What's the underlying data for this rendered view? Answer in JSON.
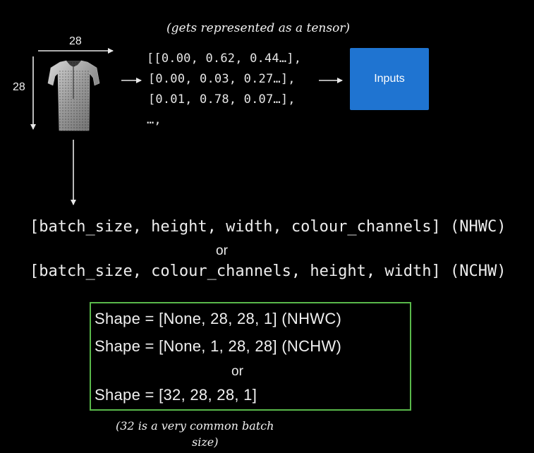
{
  "annotation_top": "(gets represented as a tensor)",
  "image_width_label": "28",
  "image_height_label": "28",
  "tensor_lines": [
    "[[0.00, 0.62, 0.44…],",
    "[0.00, 0.03, 0.27…],",
    "[0.01, 0.78, 0.07…],",
    "…,"
  ],
  "inputs_label": "Inputs",
  "formats": {
    "nhwc": "[batch_size, height, width, colour_channels] (NHWC)",
    "or": "or",
    "nchw": "[batch_size, colour_channels, height, width] (NCHW)"
  },
  "shapes": {
    "line1": "Shape = [None, 28, 28, 1] (NHWC)",
    "line2": "Shape = [None, 1, 28, 28] (NCHW)",
    "or": "or",
    "line3": "Shape = [32, 28, 28, 1]"
  },
  "annotation_bottom_line1": "(32 is a very common batch",
  "annotation_bottom_line2": "size)",
  "colors": {
    "inputs_box": "#1f74d1",
    "shape_box_border": "#59b84a",
    "background": "#000000"
  }
}
